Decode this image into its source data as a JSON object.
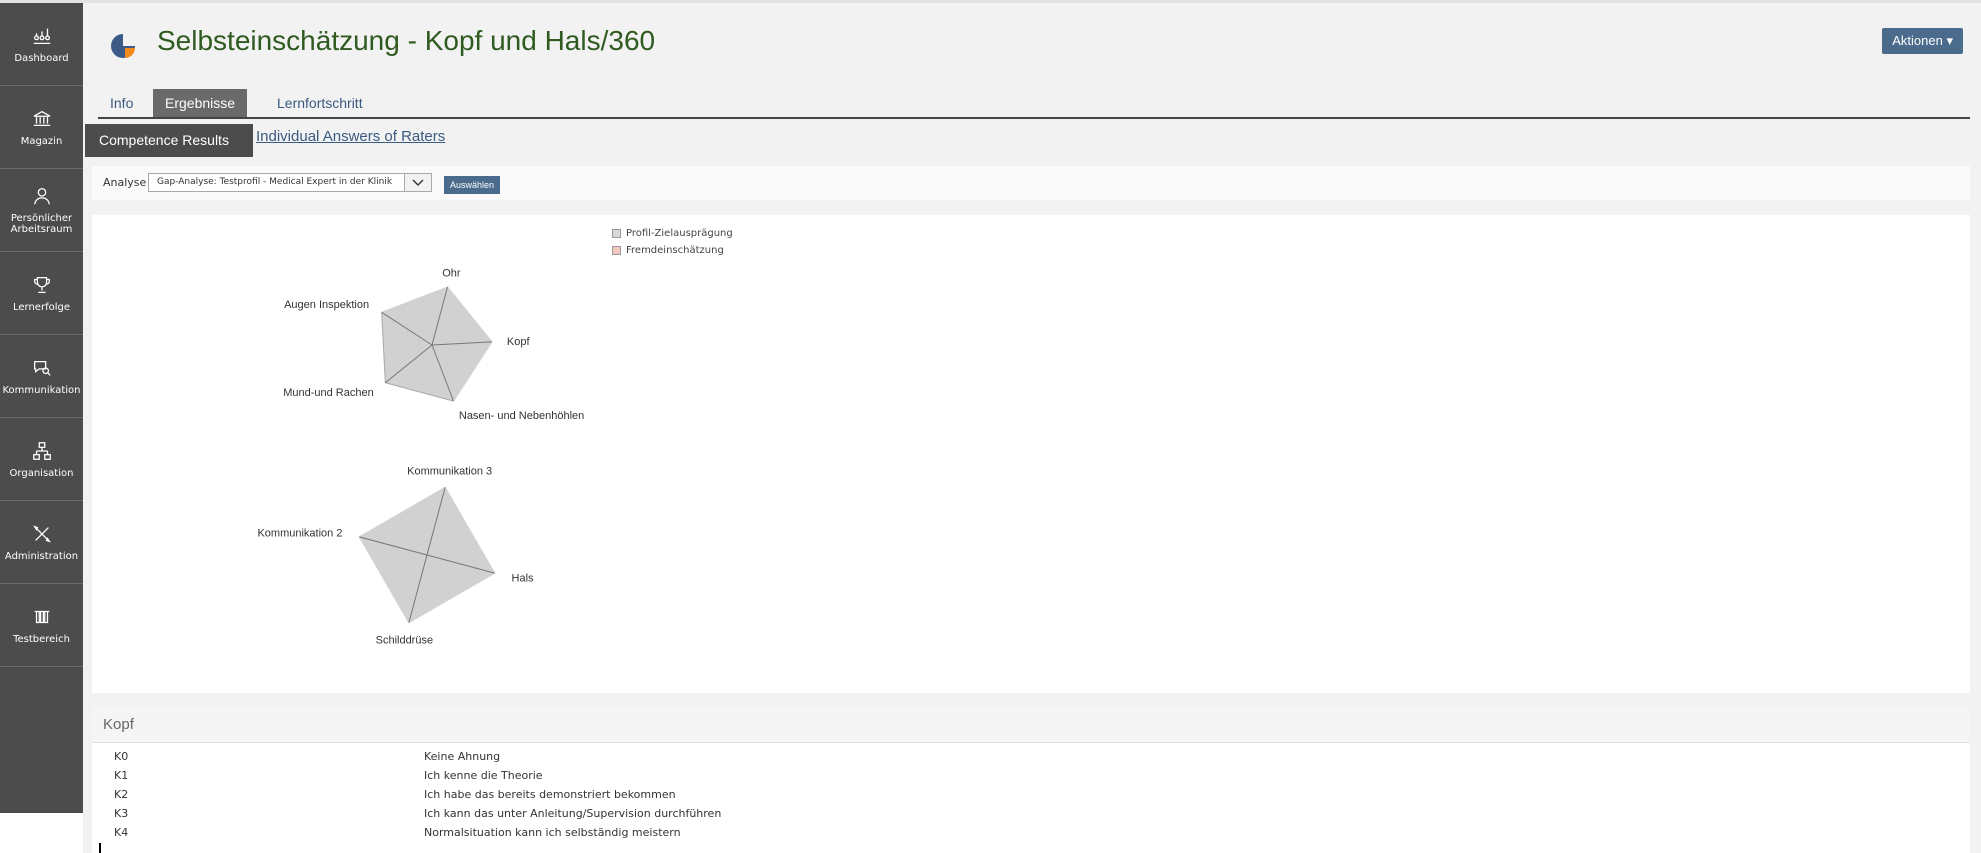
{
  "sidebar": {
    "items": [
      {
        "label": "Dashboard",
        "icon": "dashboard-icon"
      },
      {
        "label": "Magazin",
        "icon": "bank-icon"
      },
      {
        "label": "Persönlicher Arbeitsraum",
        "icon": "user-icon"
      },
      {
        "label": "Lernerfolge",
        "icon": "trophy-icon"
      },
      {
        "label": "Kommunikation",
        "icon": "chat-icon"
      },
      {
        "label": "Organisation",
        "icon": "org-chart-icon"
      },
      {
        "label": "Administration",
        "icon": "tools-icon"
      },
      {
        "label": "Testbereich",
        "icon": "flask-icon"
      }
    ]
  },
  "header": {
    "title": "Selbsteinschätzung - Kopf und Hals/360",
    "actions_label": "Aktionen"
  },
  "tabs": [
    {
      "label": "Info",
      "active": false
    },
    {
      "label": "Ergebnisse",
      "active": true
    },
    {
      "label": "Lernfortschritt",
      "active": false
    }
  ],
  "subtabs": {
    "active": "Competence Results",
    "link": "Individual Answers of Raters"
  },
  "analysis": {
    "label": "Analyse",
    "selected": "Gap-Analyse: Testprofil - Medical Expert in der Klinik",
    "button": "Auswählen"
  },
  "legend": [
    {
      "name": "Profil-Zielausprägung",
      "color": "#d8d8d8"
    },
    {
      "name": "Fremdeinschätzung",
      "color": "#f3c7c0"
    }
  ],
  "chart_data": [
    {
      "type": "radar",
      "categories": [
        "Ohr",
        "Kopf",
        "Nasen- und Nebenhöhlen",
        "Mund-und Rachen",
        "Augen Inspektion"
      ],
      "max": 4,
      "series": [
        {
          "name": "Profil-Zielausprägung",
          "values": [
            4,
            4,
            4,
            4,
            4
          ]
        },
        {
          "name": "Fremdeinschätzung",
          "values": [
            4,
            4,
            4,
            0,
            4
          ]
        }
      ]
    },
    {
      "type": "radar",
      "categories": [
        "Kommunikation 3",
        "Hals",
        "Schilddrüse",
        "Kommunikation 2"
      ],
      "max": 4,
      "series": [
        {
          "name": "Profil-Zielausprägung",
          "values": [
            4,
            4,
            4,
            4
          ]
        },
        {
          "name": "Fremdeinschätzung",
          "values": [
            4,
            4,
            4,
            4
          ]
        }
      ]
    }
  ],
  "kopf": {
    "title": "Kopf",
    "rows": [
      {
        "code": "K0",
        "desc": "Keine Ahnung"
      },
      {
        "code": "K1",
        "desc": "Ich kenne die Theorie"
      },
      {
        "code": "K2",
        "desc": "Ich habe das bereits demonstriert bekommen"
      },
      {
        "code": "K3",
        "desc": "Ich kann das unter Anleitung/Supervision durchführen"
      },
      {
        "code": "K4",
        "desc": "Normalsituation kann ich selbständig meistern"
      }
    ]
  }
}
